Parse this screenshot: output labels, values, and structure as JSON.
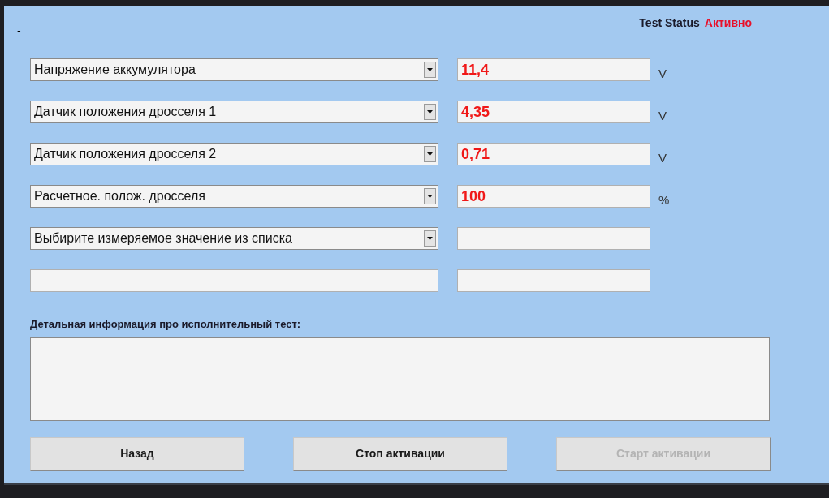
{
  "header": {
    "title": "-",
    "status_label": "Test Status",
    "status_value": "Активно"
  },
  "rows": [
    {
      "kind": "select",
      "label": "Напряжение аккумулятора",
      "value": "11,4",
      "unit": "V"
    },
    {
      "kind": "select",
      "label": "Датчик положения дросселя 1",
      "value": "4,35",
      "unit": "V"
    },
    {
      "kind": "select",
      "label": "Датчик положения дросселя 2",
      "value": "0,71",
      "unit": "V"
    },
    {
      "kind": "select",
      "label": "Расчетное. полож. дросселя",
      "value": "100",
      "unit": "%"
    },
    {
      "kind": "select",
      "label": "Выбирите измеряемое значение из списка"
    },
    {
      "kind": "text"
    }
  ],
  "details": {
    "label": "Детальная информация про исполнительный тест:"
  },
  "buttons": [
    {
      "label": "Назад",
      "disabled": false
    },
    {
      "label": "Стоп активации",
      "disabled": false
    },
    {
      "label": "Старт активации",
      "disabled": true
    }
  ]
}
